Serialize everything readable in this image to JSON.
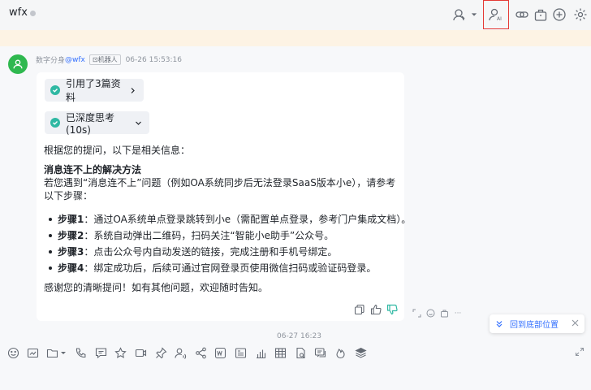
{
  "header": {
    "chat_name": "wfx",
    "icons": [
      "search-user-icon",
      "dropdown-caret-icon",
      "ai-user-icon",
      "link-icon",
      "toolbox-icon",
      "add-icon",
      "settings-icon"
    ]
  },
  "message": {
    "sender": "数字分身",
    "mention": "@wfx",
    "robot_tag": "机器人",
    "time": "06-26 15:53:16",
    "refs_chip": "引用了3篇资料",
    "thinking_chip": "已深度思考(10s)",
    "intro": "根据您的提问，以下是相关信息：",
    "section_title": "消息连不上的解决方法",
    "paragraph": "若您遇到“消息连不上”问题（例如OA系统同步后无法登录SaaS版本小e），请参考以下步骤：",
    "steps": [
      {
        "label": "步骤1",
        "text": "：通过OA系统单点登录跳转到小e（需配置单点登录，参考门户集成文档）。"
      },
      {
        "label": "步骤2",
        "text": "：系统自动弹出二维码，扫码关注“智能小e助手”公众号。"
      },
      {
        "label": "步骤3",
        "text": "：点击公众号内自动发送的链接，完成注册和手机号绑定。"
      },
      {
        "label": "步骤4",
        "text": "：绑定成功后，后续可通过官网登录页使用微信扫码或验证码登录。"
      }
    ],
    "closing": "感谢您的清晰提问！如有其他问题，欢迎随时告知。",
    "react_more": "···"
  },
  "jump_bottom_label": "回到底部位置",
  "date_divider": "06-27 16:23",
  "colors": {
    "accent": "#3370ff",
    "check": "#2fb8a3",
    "avatar": "#2fb84f",
    "notice": "#fdf3e4",
    "highlight": "#e53935"
  }
}
